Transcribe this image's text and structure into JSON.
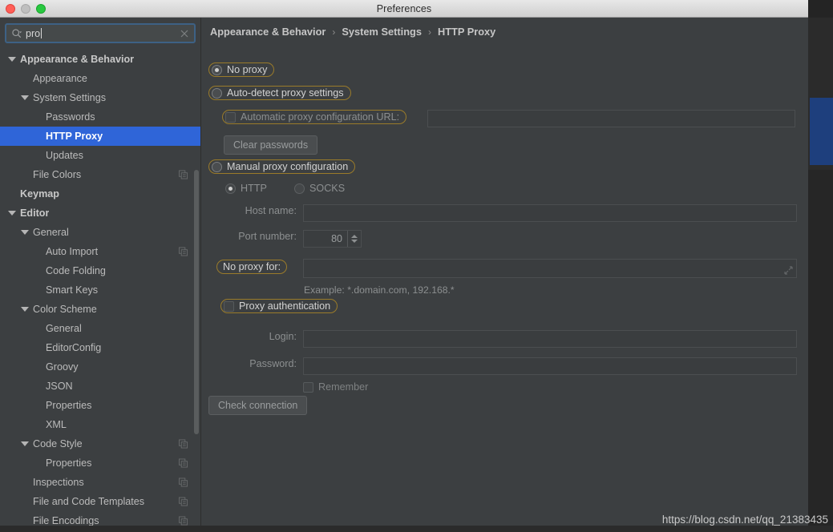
{
  "window": {
    "title": "Preferences",
    "traffic_lights": [
      "close-button",
      "minimize-button",
      "zoom-button"
    ]
  },
  "search": {
    "value": "pro",
    "placeholder": "",
    "icon": "search-icon",
    "clear_icon": "clear-icon"
  },
  "sidebar": {
    "items": [
      {
        "label": "Appearance & Behavior",
        "indent": 0,
        "twisty": "down",
        "bold": true,
        "selected": false,
        "copy": false
      },
      {
        "label": "Appearance",
        "indent": 1,
        "twisty": "none",
        "bold": false,
        "selected": false,
        "copy": false
      },
      {
        "label": "System Settings",
        "indent": 1,
        "twisty": "down",
        "bold": false,
        "selected": false,
        "copy": false
      },
      {
        "label": "Passwords",
        "indent": 2,
        "twisty": "none",
        "bold": false,
        "selected": false,
        "copy": false
      },
      {
        "label": "HTTP Proxy",
        "indent": 2,
        "twisty": "none",
        "bold": true,
        "selected": true,
        "copy": false
      },
      {
        "label": "Updates",
        "indent": 2,
        "twisty": "none",
        "bold": false,
        "selected": false,
        "copy": false
      },
      {
        "label": "File Colors",
        "indent": 1,
        "twisty": "none",
        "bold": false,
        "selected": false,
        "copy": true
      },
      {
        "label": "Keymap",
        "indent": 0,
        "twisty": "none",
        "bold": true,
        "selected": false,
        "copy": false
      },
      {
        "label": "Editor",
        "indent": 0,
        "twisty": "down",
        "bold": true,
        "selected": false,
        "copy": false
      },
      {
        "label": "General",
        "indent": 1,
        "twisty": "down",
        "bold": false,
        "selected": false,
        "copy": false
      },
      {
        "label": "Auto Import",
        "indent": 2,
        "twisty": "none",
        "bold": false,
        "selected": false,
        "copy": true
      },
      {
        "label": "Code Folding",
        "indent": 2,
        "twisty": "none",
        "bold": false,
        "selected": false,
        "copy": false
      },
      {
        "label": "Smart Keys",
        "indent": 2,
        "twisty": "none",
        "bold": false,
        "selected": false,
        "copy": false
      },
      {
        "label": "Color Scheme",
        "indent": 1,
        "twisty": "down",
        "bold": false,
        "selected": false,
        "copy": false
      },
      {
        "label": "General",
        "indent": 2,
        "twisty": "none",
        "bold": false,
        "selected": false,
        "copy": false
      },
      {
        "label": "EditorConfig",
        "indent": 2,
        "twisty": "none",
        "bold": false,
        "selected": false,
        "copy": false
      },
      {
        "label": "Groovy",
        "indent": 2,
        "twisty": "none",
        "bold": false,
        "selected": false,
        "copy": false
      },
      {
        "label": "JSON",
        "indent": 2,
        "twisty": "none",
        "bold": false,
        "selected": false,
        "copy": false
      },
      {
        "label": "Properties",
        "indent": 2,
        "twisty": "none",
        "bold": false,
        "selected": false,
        "copy": false
      },
      {
        "label": "XML",
        "indent": 2,
        "twisty": "none",
        "bold": false,
        "selected": false,
        "copy": false
      },
      {
        "label": "Code Style",
        "indent": 1,
        "twisty": "down",
        "bold": false,
        "selected": false,
        "copy": true
      },
      {
        "label": "Properties",
        "indent": 2,
        "twisty": "none",
        "bold": false,
        "selected": false,
        "copy": true
      },
      {
        "label": "Inspections",
        "indent": 1,
        "twisty": "none",
        "bold": false,
        "selected": false,
        "copy": true
      },
      {
        "label": "File and Code Templates",
        "indent": 1,
        "twisty": "none",
        "bold": false,
        "selected": false,
        "copy": true
      },
      {
        "label": "File Encodings",
        "indent": 1,
        "twisty": "none",
        "bold": false,
        "selected": false,
        "copy": true
      }
    ]
  },
  "breadcrumb": {
    "items": [
      "Appearance & Behavior",
      "System Settings",
      "HTTP Proxy"
    ],
    "separator": "›"
  },
  "proxy": {
    "no_proxy_label": "No proxy",
    "no_proxy_selected": true,
    "auto_detect_label": "Auto-detect proxy settings",
    "auto_detect_selected": false,
    "auto_config_url_label": "Automatic proxy configuration URL:",
    "auto_config_url_checked": false,
    "auto_config_url_value": "",
    "clear_passwords_label": "Clear passwords",
    "manual_label": "Manual proxy configuration",
    "manual_selected": false,
    "http_label": "HTTP",
    "http_selected": true,
    "socks_label": "SOCKS",
    "socks_selected": false,
    "host_name_label": "Host name:",
    "host_name_value": "",
    "port_number_label": "Port number:",
    "port_number_value": "80",
    "no_proxy_for_label": "No proxy for:",
    "no_proxy_for_value": "",
    "example_text": "Example: *.domain.com, 192.168.*",
    "proxy_auth_label": "Proxy authentication",
    "proxy_auth_checked": false,
    "login_label": "Login:",
    "login_value": "",
    "password_label": "Password:",
    "password_value": "",
    "remember_label": "Remember",
    "remember_checked": false,
    "check_connection_label": "Check connection"
  },
  "watermark": {
    "text": "https://blog.csdn.net/qq_21383435"
  },
  "colors": {
    "selection_blue": "#2f65d8",
    "search_highlight_ring": "#9a7b2a",
    "dialog_bg": "#3c3f41",
    "desktop_bg": "#242424",
    "bg_accent_blue": "#1e3f7d"
  }
}
